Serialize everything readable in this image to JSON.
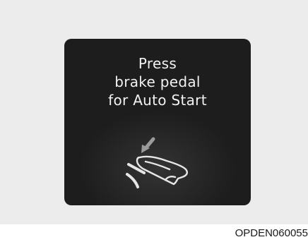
{
  "display": {
    "message_lines": [
      "Press",
      "brake pedal",
      "for Auto Start"
    ]
  },
  "icons": {
    "pedal": "brake-pedal-press-icon"
  },
  "caption": "OPDEN060055",
  "colors": {
    "display_background": "#1d1d1d",
    "display_text": "#f2f2f2",
    "icon_arrow": "#9a9a9a",
    "icon_shoe": "#e6e6e6",
    "page_background": "#ececec"
  }
}
